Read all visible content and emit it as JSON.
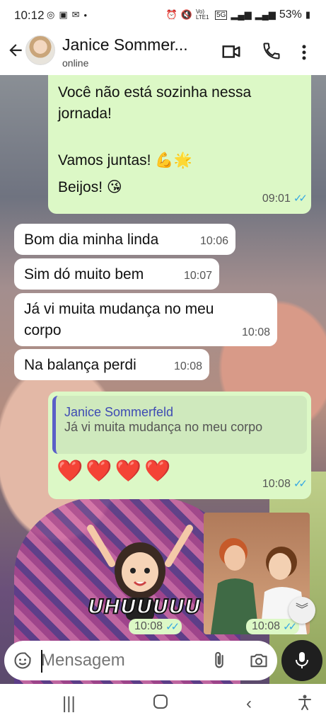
{
  "status_bar": {
    "time": "10:12",
    "signal_label": "Vo) LTE1",
    "network": "5G",
    "battery": "53%"
  },
  "header": {
    "contact_name": "Janice Sommer...",
    "status": "online"
  },
  "messages": [
    {
      "direction": "out",
      "lines": [
        "Você não está sozinha nessa",
        "jornada!",
        "",
        "Vamos juntas! 💪🌟",
        "Beijos! 😘"
      ],
      "time": "09:01",
      "ticks": "✓✓"
    },
    {
      "direction": "in",
      "text": "Bom dia minha linda",
      "time": "10:06"
    },
    {
      "direction": "in",
      "text": "Sim dó muito bem",
      "time": "10:07"
    },
    {
      "direction": "in",
      "lines": [
        "Já vi muita mudança no meu",
        "corpo"
      ],
      "time": "10:08"
    },
    {
      "direction": "in",
      "text": "Na balança perdi",
      "time": "10:08"
    },
    {
      "direction": "out",
      "quote": {
        "author": "Janice Sommerfeld",
        "text": "Já vi muita mudança no meu corpo"
      },
      "text": "❤️❤️❤️❤️",
      "time": "10:08",
      "ticks": "✓✓"
    },
    {
      "direction": "out",
      "type": "sticker",
      "sticker_text": "UHUUUUU",
      "time": "10:08",
      "ticks": "✓✓"
    },
    {
      "direction": "out",
      "type": "sticker-gif",
      "time": "10:08",
      "ticks": "✓✓"
    }
  ],
  "input": {
    "placeholder": "Mensagem"
  },
  "colors": {
    "outgoing_bubble": "#dcf8c6",
    "incoming_bubble": "#ffffff",
    "read_ticks": "#34a7e3",
    "quote_bar": "#5a5fc8"
  },
  "icons": [
    "back-arrow-icon",
    "video-call-icon",
    "phone-icon",
    "more-icon",
    "emoji-sticker-icon",
    "attach-icon",
    "camera-icon",
    "mic-icon",
    "scroll-down-icon",
    "recents-icon",
    "home-icon",
    "back-nav-icon",
    "accessibility-icon"
  ]
}
